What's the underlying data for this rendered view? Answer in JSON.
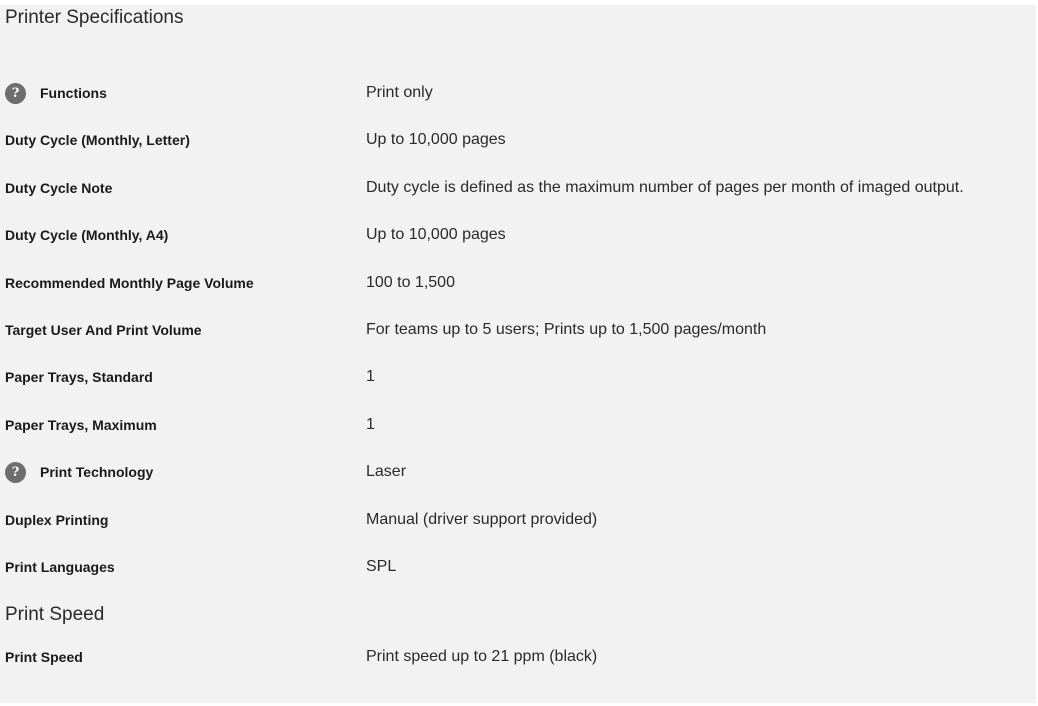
{
  "section_title": "Printer Specifications",
  "rows": [
    {
      "label": "Functions",
      "value": "Print only",
      "help": true
    },
    {
      "label": "Duty Cycle (Monthly, Letter)",
      "value": "Up to 10,000 pages"
    },
    {
      "label": "Duty Cycle Note",
      "value": "Duty cycle is defined as the maximum number of pages per month of imaged output."
    },
    {
      "label": "Duty Cycle (Monthly, A4)",
      "value": "Up to 10,000 pages"
    },
    {
      "label": "Recommended Monthly Page Volume",
      "value": "100 to 1,500"
    },
    {
      "label": "Target User And Print Volume",
      "value": "For teams up to 5 users; Prints up to 1,500 pages/month"
    },
    {
      "label": "Paper Trays, Standard",
      "value": "1"
    },
    {
      "label": "Paper Trays, Maximum",
      "value": "1"
    },
    {
      "label": "Print Technology",
      "value": "Laser",
      "help": true
    },
    {
      "label": "Duplex Printing",
      "value": "Manual (driver support provided)"
    },
    {
      "label": "Print Languages",
      "value": "SPL"
    }
  ],
  "speed_section_title": "Print Speed",
  "speed_row": {
    "label": "Print Speed",
    "value": "Print speed up to 21 ppm (black)"
  },
  "help_glyph": "?"
}
